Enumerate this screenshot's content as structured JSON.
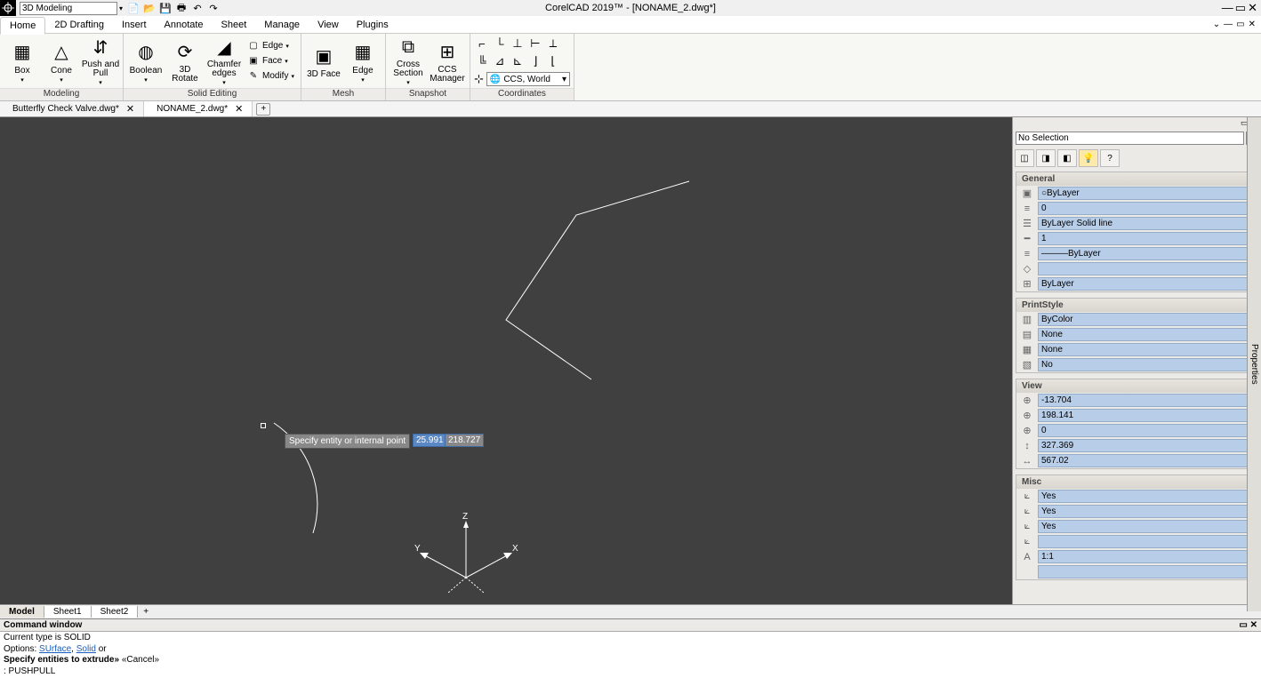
{
  "titlebar": {
    "workspace": "3D Modeling",
    "title": "CorelCAD 2019™ - [NONAME_2.dwg*]"
  },
  "menutabs": [
    "Home",
    "2D Drafting",
    "Insert",
    "Annotate",
    "Sheet",
    "Manage",
    "View",
    "Plugins"
  ],
  "menutab_active": 0,
  "ribbon": {
    "modeling": {
      "label": "Modeling",
      "box": "Box",
      "cone": "Cone",
      "push": "Push and\nPull"
    },
    "solidediting": {
      "label": "Solid Editing",
      "boolean": "Boolean",
      "rotate": "3D Rotate",
      "chamfer": "Chamfer\nedges",
      "edge": "Edge",
      "face": "Face",
      "modify": "Modify"
    },
    "mesh": {
      "label": "Mesh",
      "face3d": "3D Face",
      "edge": "Edge"
    },
    "snapshot": {
      "label": "Snapshot",
      "cross": "Cross\nSection",
      "ccs": "CCS\nManager"
    },
    "coordinates": {
      "label": "Coordinates",
      "ccs_world": "CCS, World"
    }
  },
  "doctabs": [
    {
      "name": "Butterfly Check Valve.dwg*",
      "active": false
    },
    {
      "name": "NONAME_2.dwg*",
      "active": true
    }
  ],
  "canvas_tooltip": "Specify entity or internal point",
  "canvas_coord1": "25.991",
  "canvas_coord2": "218.727",
  "axis_labels": {
    "x": "X",
    "y": "Y",
    "z": "Z"
  },
  "sheettabs": [
    "Model",
    "Sheet1",
    "Sheet2"
  ],
  "sheettab_active": 0,
  "cmdwin": {
    "title": "Command window",
    "line1": "Current type is SOLID",
    "line2_pre": "Options: ",
    "line2_a": "SUrface",
    "line2_b": "Solid",
    "line2_post": " or",
    "line3_a": "Specify entities to extrude»",
    "line3_b": " «Cancel»",
    "line4": ": PUSHPULL"
  },
  "props": {
    "selection": "No Selection",
    "help": "?",
    "general": {
      "header": "General",
      "layer": "ByLayer",
      "color": "0",
      "ltype": "ByLayer    Solid line",
      "lweight": "1",
      "lscale": "ByLayer",
      "transparency": "",
      "plotstylesummary": "ByLayer"
    },
    "printstyle": {
      "header": "PrintStyle",
      "bycolor": "ByColor",
      "none1": "None",
      "none2": "None",
      "no": "No"
    },
    "view": {
      "header": "View",
      "x": "-13.704",
      "y": "198.141",
      "z": "0",
      "h": "327.369",
      "w": "567.02"
    },
    "misc": {
      "header": "Misc",
      "yes1": "Yes",
      "yes2": "Yes",
      "yes3": "Yes",
      "blank": "",
      "scale": "1:1"
    },
    "sidetab": "Properties"
  }
}
